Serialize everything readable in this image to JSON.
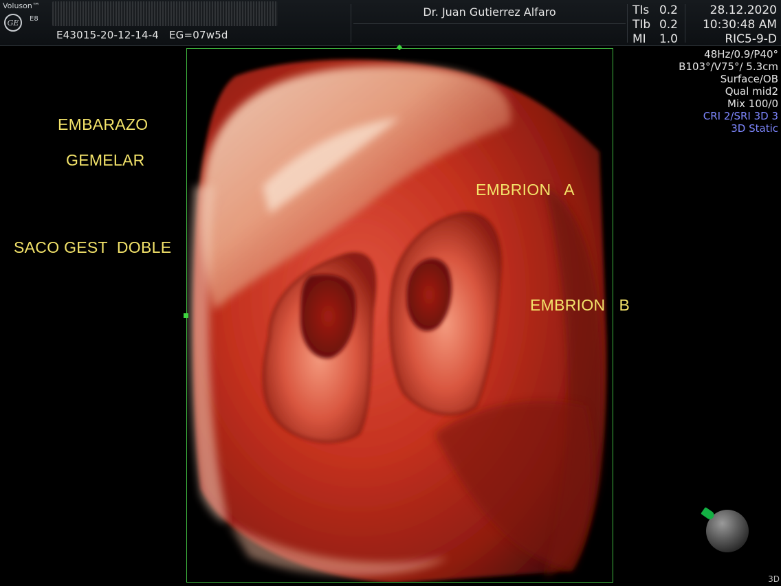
{
  "header": {
    "brand": "Voluson™",
    "model": "E8",
    "logo_text": "GE",
    "patient_id": "E43015-20-12-14-4",
    "gestational_age": "EG=07w5d",
    "doctor": "Dr. Juan Gutierrez Alfaro",
    "params": [
      {
        "label": "TIs",
        "value": "0.2"
      },
      {
        "label": "TIb",
        "value": "0.2"
      },
      {
        "label": "MI",
        "value": "1.0"
      }
    ],
    "date": "28.12.2020",
    "time": "10:30:48 AM",
    "probe": "RIC5-9-D"
  },
  "settings": {
    "lines": [
      "48Hz/0.9/P40°",
      "B103°/V75°/ 5.3cm",
      "Surface/OB",
      "Qual mid2",
      "Mix 100/0"
    ],
    "highlight_lines": [
      "CRI 2/SRI 3D 3",
      "3D Static"
    ],
    "highlight_color": "#7e87ff"
  },
  "annotations": {
    "embarazo": "EMBARAZO",
    "gemelar": "GEMELAR",
    "saco": "SACO GEST  DOBLE",
    "embrion_a": "EMBRION   A",
    "embrion_b": "EMBRION   B"
  },
  "footer": {
    "mode_tag": "3D"
  },
  "colors": {
    "annotation": "#f3e36a",
    "frame": "#3fb93f",
    "orientation_marker": "#13b043"
  }
}
